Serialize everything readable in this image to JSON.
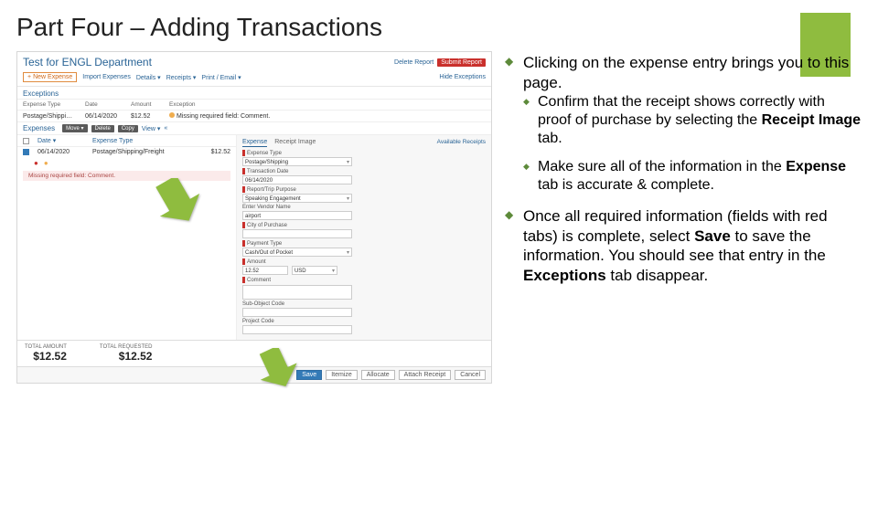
{
  "slide": {
    "title": "Part Four – Adding Transactions"
  },
  "app": {
    "title": "Test for ENGL Department",
    "headerActions": {
      "delete": "Delete Report",
      "submit": "Submit Report"
    },
    "toolbar": {
      "newExpense": "New Expense",
      "import": "Import Expenses",
      "details": "Details",
      "receipts": "Receipts",
      "print": "Print / Email",
      "hide": "Hide Exceptions"
    },
    "exceptions": {
      "label": "Exceptions",
      "cols": {
        "type": "Expense Type",
        "date": "Date",
        "amount": "Amount",
        "exc": "Exception"
      },
      "row": {
        "type": "Postage/Shippi…",
        "date": "06/14/2020",
        "amount": "$12.52",
        "exc": "Missing required field: Comment."
      }
    },
    "expenses": {
      "label": "Expenses",
      "bar": {
        "move": "Move ▾",
        "delete": "Delete",
        "copy": "Copy",
        "view": "View ▾",
        "lt": "«"
      },
      "headCols": {
        "date": "Date ▾",
        "type": "Expense Type"
      },
      "row": {
        "date": "06/14/2020",
        "type": "Postage/Shipping/Freight",
        "amount": "$12.52"
      },
      "warning": "Missing required field: Comment."
    },
    "form": {
      "tabs": {
        "expense": "Expense",
        "receipt": "Receipt Image"
      },
      "available": "Available Receipts",
      "fields": {
        "expenseType": {
          "label": "Expense Type",
          "value": "Postage/Shipping"
        },
        "transDate": {
          "label": "Transaction Date",
          "value": "06/14/2020"
        },
        "purpose": {
          "label": "Report/Trip Purpose",
          "value": "Speaking Engagement"
        },
        "vendor": {
          "label": "Enter Vendor Name",
          "value": "airport"
        },
        "city": {
          "label": "City of Purchase",
          "value": ""
        },
        "payment": {
          "label": "Payment Type",
          "value": "Cash/Out of Pocket"
        },
        "amount": {
          "label": "Amount",
          "value": "12.52",
          "currency": "USD"
        },
        "comment": {
          "label": "Comment",
          "value": ""
        },
        "subobj": {
          "label": "Sub-Object Code",
          "value": ""
        },
        "project": {
          "label": "Project Code",
          "value": ""
        }
      }
    },
    "totals": {
      "amount": {
        "label": "TOTAL AMOUNT",
        "value": "$12.52"
      },
      "requested": {
        "label": "TOTAL REQUESTED",
        "value": "$12.52"
      }
    },
    "footer": {
      "save": "Save",
      "itemize": "Itemize",
      "allocate": "Allocate",
      "attach": "Attach Receipt",
      "cancel": "Cancel"
    }
  },
  "notes": {
    "b1": "Clicking on the expense entry brings you to this page.",
    "b1a_pre": "Confirm that the receipt shows correctly with proof of purchase by selecting the ",
    "b1a_bold": "Receipt Image",
    "b1a_post": " tab.",
    "b1b_pre": "Make sure all of the information in the ",
    "b1b_bold": "Expense",
    "b1b_post": " tab is accurate & complete.",
    "b2_pre": "Once all required information (fields with red tabs) is complete, select ",
    "b2_bold1": "Save",
    "b2_mid": " to save the information. You should see that entry in the ",
    "b2_bold2": "Exceptions",
    "b2_post": " tab disappear."
  }
}
